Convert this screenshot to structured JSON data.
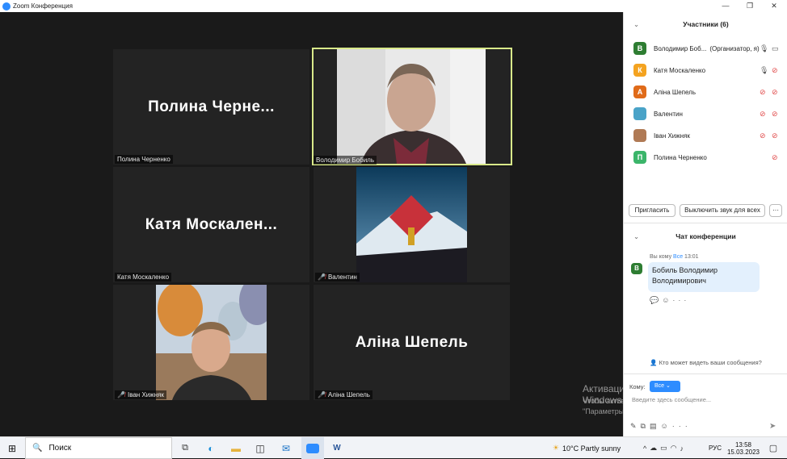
{
  "window": {
    "title": "Zoom Конференция"
  },
  "tiles": [
    {
      "big": "Полина  Черне...",
      "label": "Полина Черненко"
    },
    {
      "label": "Володимир Бобиль"
    },
    {
      "big": "Катя  Москален...",
      "label": "Катя Москаленко"
    },
    {
      "label": "Валентин"
    },
    {
      "label": "Іван Хижняк"
    },
    {
      "big": "Аліна Шепель",
      "label": "Аліна Шепель"
    }
  ],
  "participants": {
    "header": "Участники (6)",
    "items": [
      {
        "initial": "В",
        "name": "Володимир Боб...",
        "role": "(Организатор, я)",
        "color": "#2e7d32"
      },
      {
        "initial": "К",
        "name": "Катя Москаленко",
        "color": "#f4a320"
      },
      {
        "initial": "А",
        "name": "Аліна Шепель",
        "color": "#e06b1a"
      },
      {
        "initial": "",
        "name": "Валентин",
        "color": "#4aa3c8"
      },
      {
        "initial": "",
        "name": "Іван Хижняк",
        "color": "#b07a55"
      },
      {
        "initial": "П",
        "name": "Полина Черненко",
        "color": "#3bb56a"
      }
    ],
    "invite": "Пригласить",
    "mute_all": "Выключить звук для всех",
    "more": "···"
  },
  "chat": {
    "header": "Чат конференции",
    "from": "Вы кому",
    "to": "Все",
    "time": "13:01",
    "message": "Бобиль Володимир Володимирович",
    "who_sees": "Кто может видеть ваши сообщения?",
    "to_label": "Кому:",
    "to_value": "Все",
    "placeholder": "Введите здесь сообщение..."
  },
  "watermark": {
    "line1": "Активация Windows",
    "line2": "Чтобы активировать Windows, перейдите в раздел",
    "line3": "\"Параметры\"."
  },
  "taskbar": {
    "search": "Поиск",
    "weather": "10°C  Partly sunny",
    "lang": "РУС",
    "time": "13:58",
    "date": "15.03.2023"
  },
  "colors": {
    "accent": "#2d8cff",
    "highlight": "#d9e98a"
  }
}
